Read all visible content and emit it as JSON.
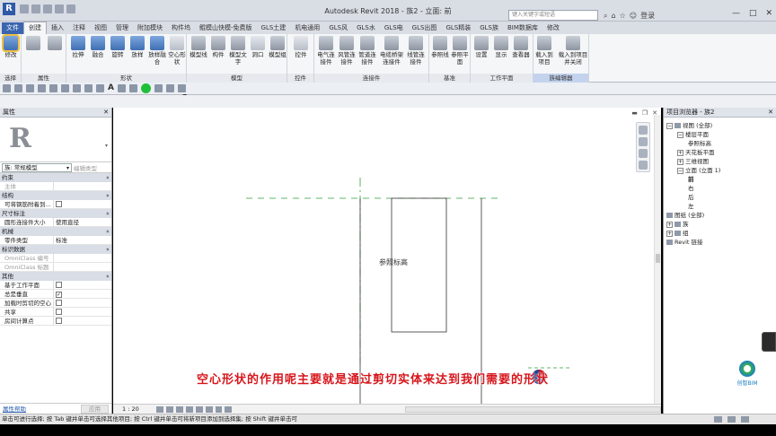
{
  "window": {
    "title": "Autodesk Revit 2018 -    族2 - 立面: 前",
    "search_placeholder": "键入关键字或短语",
    "login": "登录"
  },
  "tabs": [
    "文件",
    "创建",
    "插入",
    "注释",
    "视图",
    "管理",
    "附加模块",
    "构件坞",
    "鲲模山快模-免费版",
    "GLS土建",
    "机电通用",
    "GLS风",
    "GLS水",
    "GLS电",
    "GLS出图",
    "GLS精装",
    "GLS族",
    "BIM数据库",
    "修改"
  ],
  "ribbon": {
    "buttons": {
      "modify": "修改",
      "extrude": "拉伸",
      "blend": "融合",
      "revolve": "旋转",
      "sweep": "放样",
      "swept_blend": "放样融合",
      "void_forms": "空心形状",
      "model_line": "模型线",
      "component": "构件",
      "model_text": "模型文字",
      "opening": "洞口",
      "model_group": "模型组",
      "control": "控件",
      "electrical_connector": "电气连接件",
      "duct_connector": "风管连接件",
      "pipe_connector": "管道连接件",
      "cable_tray_connector": "电缆桥架连接件",
      "conduit_connector": "线管连接件",
      "ref_line": "参照线",
      "ref_plane": "参照平面",
      "set": "设置",
      "show": "显示",
      "viewer": "查看器",
      "load_into_project": "载入到项目",
      "load_close": "载入到项目并关闭"
    },
    "groups": {
      "select": "选择",
      "properties": "属性",
      "forms": "形状",
      "model": "模型",
      "control": "控件",
      "connectors": "连接件",
      "datum": "基准",
      "work_plane": "工作平面",
      "family_editor": "族编辑器"
    }
  },
  "properties": {
    "header": "属性",
    "close": "✕",
    "type_selector": "族: 常规模型",
    "edit_type": "编辑类型",
    "sections": [
      {
        "name": "约束",
        "rows": [
          {
            "k": "主体",
            "v": "",
            "dim": true
          }
        ]
      },
      {
        "name": "结构",
        "rows": [
          {
            "k": "可将钢筋附着到...",
            "v": "",
            "check": true,
            "checked": false
          }
        ]
      },
      {
        "name": "尺寸标注",
        "rows": [
          {
            "k": "圆形连接件大小",
            "v": "使用直径"
          }
        ]
      },
      {
        "name": "机械",
        "rows": [
          {
            "k": "零件类型",
            "v": "标准"
          }
        ]
      },
      {
        "name": "标识数据",
        "rows": [
          {
            "k": "OmniClass 编号",
            "v": "",
            "dim": true
          },
          {
            "k": "OmniClass 标题",
            "v": "",
            "dim": true
          }
        ]
      },
      {
        "name": "其他",
        "rows": [
          {
            "k": "基于工作平面",
            "v": "",
            "check": true,
            "checked": false
          },
          {
            "k": "总是垂直",
            "v": "",
            "check": true,
            "checked": true
          },
          {
            "k": "加载时剪切的空心",
            "v": "",
            "check": true,
            "checked": false
          },
          {
            "k": "共享",
            "v": "",
            "check": true,
            "checked": false
          },
          {
            "k": "房间计算点",
            "v": "",
            "check": true,
            "checked": false
          }
        ]
      }
    ],
    "help": "属性帮助",
    "apply": "应用"
  },
  "canvas": {
    "ref_level_label": "参照标高",
    "subtitle": "空心形状的作用呢主要就是通过剪切实体来达到我们需要的形状",
    "scale": "1 : 20"
  },
  "browser": {
    "header": "项目浏览器 - 族2",
    "close": "✕",
    "tree": [
      {
        "label": "视图 (全部)",
        "level": 0,
        "toggle": "−",
        "icon": true
      },
      {
        "label": "楼层平面",
        "level": 1,
        "toggle": "−"
      },
      {
        "label": "参照标高",
        "level": 2
      },
      {
        "label": "天花板平面",
        "level": 1,
        "toggle": "+"
      },
      {
        "label": "三维视图",
        "level": 1,
        "toggle": "+"
      },
      {
        "label": "立面 (立面 1)",
        "level": 1,
        "toggle": "−"
      },
      {
        "label": "前",
        "level": 2,
        "bold": true
      },
      {
        "label": "右",
        "level": 2
      },
      {
        "label": "后",
        "level": 2
      },
      {
        "label": "左",
        "level": 2
      },
      {
        "label": "图纸 (全部)",
        "level": 0,
        "icon": true
      },
      {
        "label": "族",
        "level": 0,
        "toggle": "+",
        "icon": true
      },
      {
        "label": "组",
        "level": 0,
        "toggle": "+",
        "icon": true
      },
      {
        "label": "Revit 链接",
        "level": 0,
        "icon": true
      }
    ],
    "brand": "创智BIM"
  },
  "status": {
    "text": "单击可进行选择; 按 Tab 键并单击可选择其他项目; 按 Ctrl 键并单击可将新项目添加到选择集; 按 Shift 键并单击可"
  }
}
